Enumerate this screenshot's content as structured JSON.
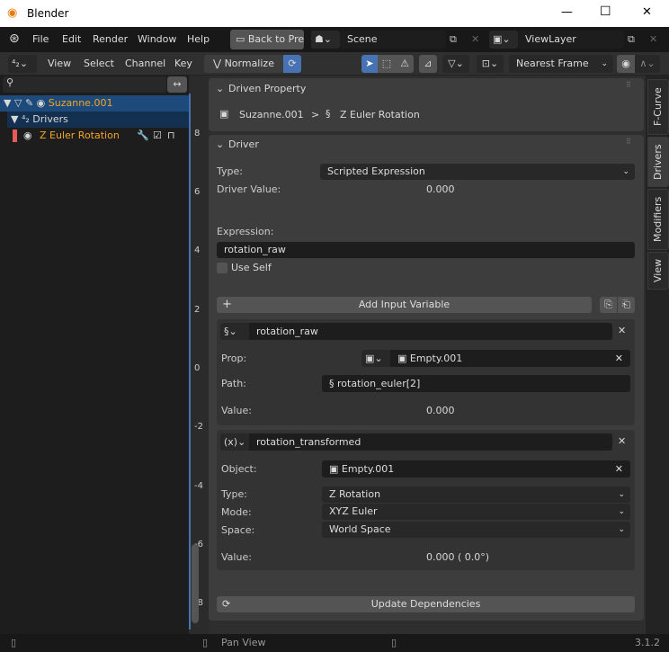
{
  "window": {
    "title": "Blender",
    "minimize": "—",
    "maximize": "☐",
    "close": "✕"
  },
  "topbar": {
    "menus": [
      "File",
      "Edit",
      "Render",
      "Window",
      "Help"
    ],
    "back_button": "Back to Pre",
    "scene": "Scene",
    "view_layer": "ViewLayer"
  },
  "header": {
    "menus": [
      "View",
      "Select",
      "Channel",
      "Key"
    ],
    "normalize": "Normalize",
    "snap_mode": "Nearest Frame"
  },
  "channels": {
    "search_placeholder": "",
    "object": "Suzanne.001",
    "drivers": "Drivers",
    "fcurve": "Z Euler Rotation"
  },
  "graph": {
    "ticks": [
      "8",
      "6",
      "4",
      "2",
      "0",
      "-2",
      "-4",
      "-6",
      "-8"
    ]
  },
  "driven_property": {
    "title": "Driven Property",
    "object": "Suzanne.001",
    "separator": ">",
    "property": "Z Euler Rotation"
  },
  "driver": {
    "title": "Driver",
    "type_label": "Type:",
    "type_value": "Scripted Expression",
    "value_label": "Driver Value:",
    "value": "0.000",
    "expression_label": "Expression:",
    "expression": "rotation_raw",
    "use_self": "Use Self",
    "use_self_checked": false,
    "add_variable": "Add Input Variable",
    "update": "Update Dependencies"
  },
  "variables": [
    {
      "name": "rotation_raw",
      "prop_label": "Prop:",
      "prop_value": "Empty.001",
      "path_label": "Path:",
      "path_value": "rotation_euler[2]",
      "value_label": "Value:",
      "value": "0.000"
    },
    {
      "name": "rotation_transformed",
      "object_label": "Object:",
      "object_value": "Empty.001",
      "type_label": "Type:",
      "type_value": "Z Rotation",
      "mode_label": "Mode:",
      "mode_value": "XYZ Euler",
      "space_label": "Space:",
      "space_value": "World Space",
      "value_label": "Value:",
      "value": "0.000 ( 0.0°)"
    }
  ],
  "tabs": [
    "F-Curve",
    "Drivers",
    "Modifiers",
    "View"
  ],
  "active_tab": "Drivers",
  "status": {
    "action": "Pan View",
    "version": "3.1.2"
  },
  "colors": {
    "accent": "#4772b3",
    "selected_row": "#1d4a7a",
    "orange_text": "#f5a623",
    "fcurve_color": "#e65a5a"
  }
}
